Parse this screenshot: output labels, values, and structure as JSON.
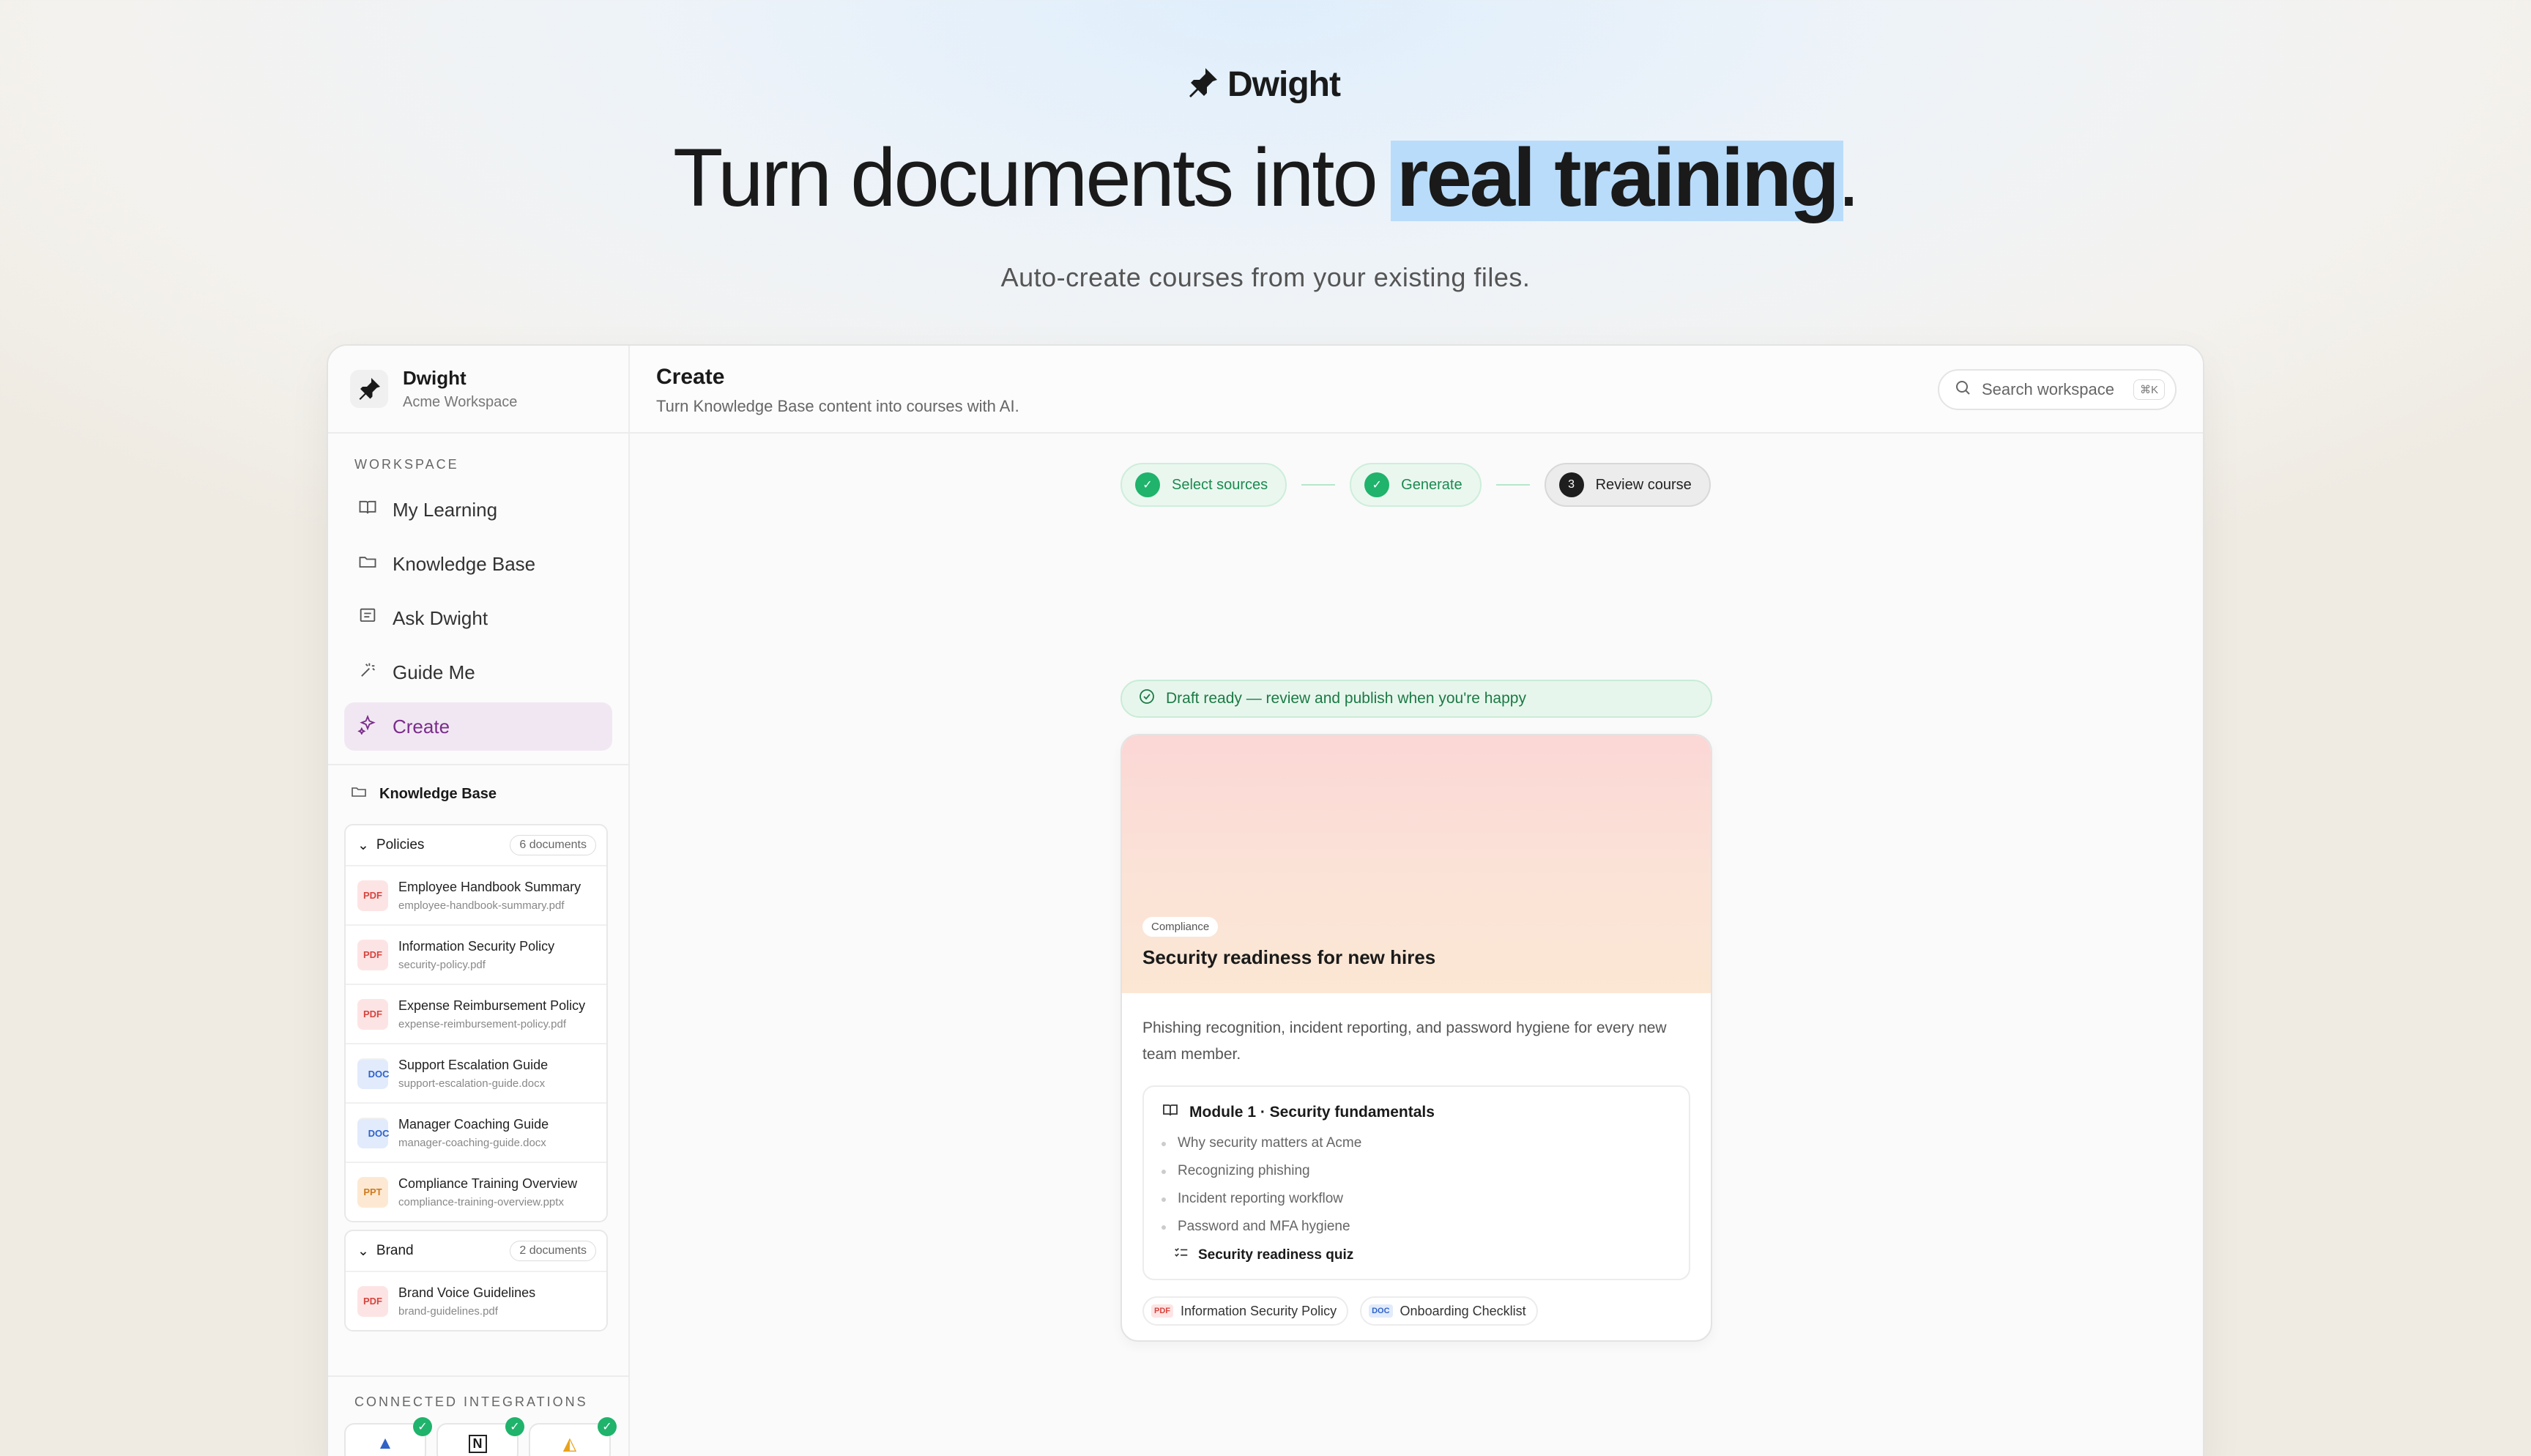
{
  "brand": {
    "name": "Dwight"
  },
  "hero": {
    "headline_pre": "Turn documents into ",
    "headline_highlight": "real training",
    "headline_post": ".",
    "subhead": "Auto-create courses from your existing files."
  },
  "sidebar": {
    "workspace_name": "Dwight",
    "workspace_sub": "Acme Workspace",
    "section_label": "WORKSPACE",
    "items": [
      {
        "label": "My Learning",
        "icon": "book-icon"
      },
      {
        "label": "Knowledge Base",
        "icon": "folder-icon"
      },
      {
        "label": "Ask Dwight",
        "icon": "chat-icon"
      },
      {
        "label": "Guide Me",
        "icon": "wand-icon"
      },
      {
        "label": "Create",
        "icon": "sparkle-icon",
        "active": true
      }
    ],
    "kb_title": "Knowledge Base",
    "folders": [
      {
        "name": "Policies",
        "count": "6 documents",
        "docs": [
          {
            "type": "PDF",
            "title": "Employee Handbook Summary",
            "file": "employee-handbook-summary.pdf"
          },
          {
            "type": "PDF",
            "title": "Information Security Policy",
            "file": "security-policy.pdf"
          },
          {
            "type": "PDF",
            "title": "Expense Reimbursement Policy",
            "file": "expense-reimbursement-policy.pdf"
          },
          {
            "type": "DOC",
            "title": "Support Escalation Guide",
            "file": "support-escalation-guide.docx"
          },
          {
            "type": "DOC",
            "title": "Manager Coaching Guide",
            "file": "manager-coaching-guide.docx"
          },
          {
            "type": "PPT",
            "title": "Compliance Training Overview",
            "file": "compliance-training-overview.pptx"
          }
        ]
      },
      {
        "name": "Brand",
        "count": "2 documents",
        "docs": [
          {
            "type": "PDF",
            "title": "Brand Voice Guidelines",
            "file": "brand-guidelines.pdf"
          }
        ]
      }
    ],
    "integrations_label": "CONNECTED INTEGRATIONS",
    "integrations": [
      {
        "icon": "atlassian-icon",
        "glyph": "▲"
      },
      {
        "icon": "notion-icon",
        "glyph": "N"
      },
      {
        "icon": "google-drive-icon",
        "glyph": "◭"
      }
    ]
  },
  "main": {
    "title": "Create",
    "subtitle": "Turn Knowledge Base content into courses with AI.",
    "search_placeholder": "Search workspace",
    "search_shortcut": "⌘K",
    "steps": [
      {
        "label": "Select sources",
        "state": "done"
      },
      {
        "label": "Generate",
        "state": "done"
      },
      {
        "label": "Review course",
        "state": "current",
        "number": "3"
      }
    ],
    "banner": "Draft ready — review and publish when you're happy",
    "course": {
      "tag": "Compliance",
      "title": "Security readiness for new hires",
      "description": "Phishing recognition, incident reporting, and password hygiene for every new team member.",
      "module_title": "Module 1 · Security fundamentals",
      "lessons": [
        "Why security matters at Acme",
        "Recognizing phishing",
        "Incident reporting workflow",
        "Password and MFA hygiene"
      ],
      "quiz": "Security readiness quiz",
      "sources": [
        {
          "type": "PDF",
          "label": "Information Security Policy"
        },
        {
          "type": "DOC",
          "label": "Onboarding Checklist"
        }
      ]
    }
  },
  "colors": {
    "accent": "#7a2d8a",
    "success": "#1fb36b",
    "highlight": "#b9dcfb"
  }
}
